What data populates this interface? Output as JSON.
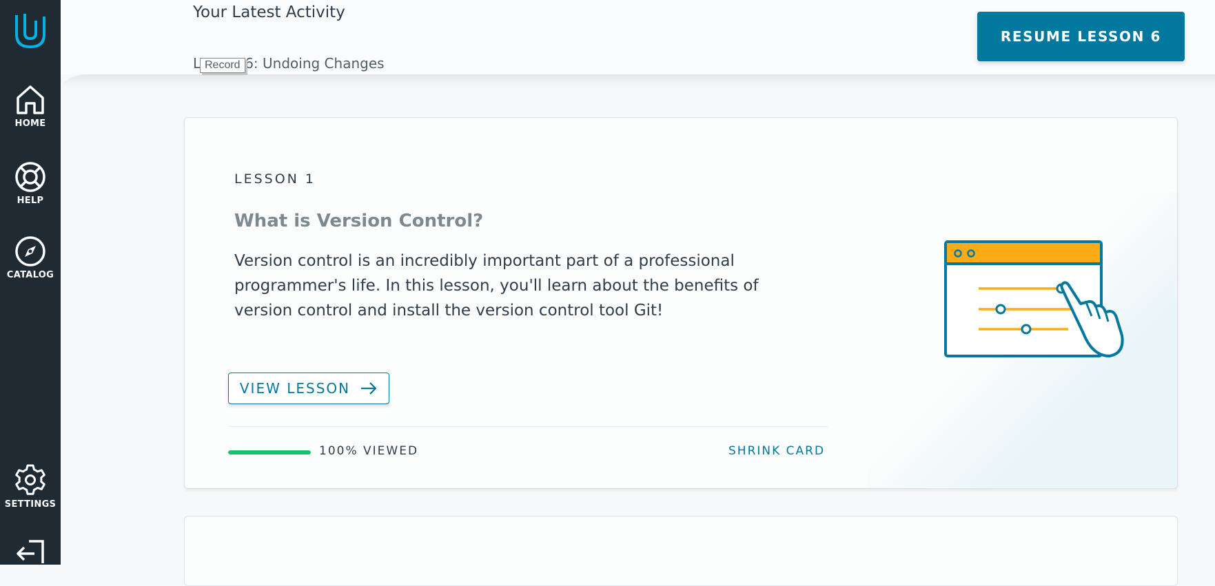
{
  "sidebar": {
    "items": [
      {
        "label": "HOME",
        "icon": "home-icon"
      },
      {
        "label": "HELP",
        "icon": "lifebuoy-icon"
      },
      {
        "label": "CATALOG",
        "icon": "compass-icon"
      },
      {
        "label": "SETTINGS",
        "icon": "gear-icon"
      }
    ],
    "logout_icon": "logout-icon",
    "logo_icon": "udacity-logo-icon"
  },
  "activity": {
    "title": "Your Latest Activity",
    "subtitle": "Lesson 6: Undoing Changes",
    "tooltip": "Record",
    "resume_label": "RESUME LESSON 6"
  },
  "lesson_card": {
    "number_label": "LESSON 1",
    "title": "What is Version Control?",
    "description": "Version control is an incredibly important part of a professional programmer's life. In this lesson, you'll learn about the benefits of version control and install the version control tool Git!",
    "view_label": "VIEW LESSON",
    "progress_percent": 100,
    "progress_label": "100% VIEWED",
    "shrink_label": "SHRINK CARD"
  },
  "colors": {
    "sidebar": "#1f2a33",
    "accent": "#02789e",
    "progress": "#15c26b",
    "illustration_orange": "#fdab16",
    "logo": "#02b3e4"
  }
}
